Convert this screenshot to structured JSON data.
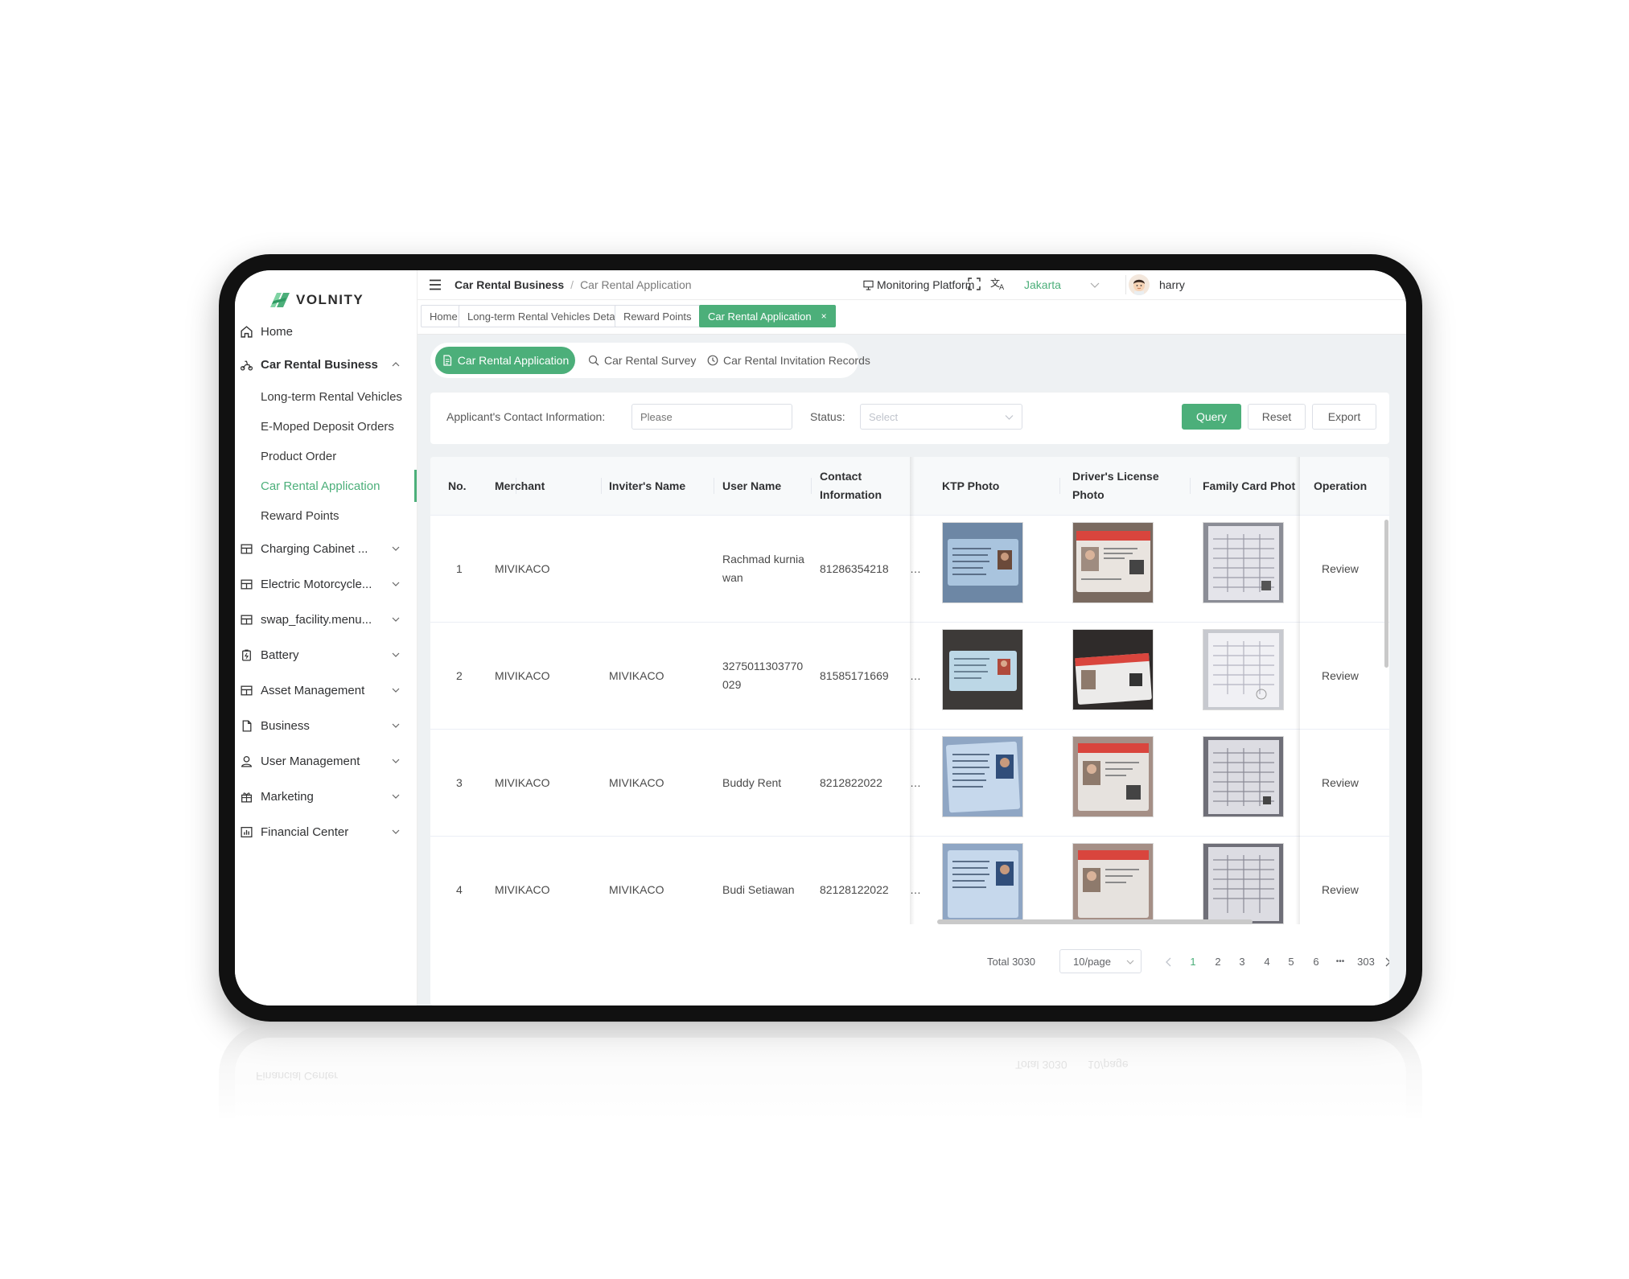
{
  "app": {
    "logo_text": "VOLNITY",
    "brand_color": "#4caf7a"
  },
  "sidebar": {
    "home": "Home",
    "car_rental_business": "Car Rental Business",
    "sub_items": [
      "Long-term Rental Vehicles",
      "E-Moped Deposit Orders",
      "Product Order",
      "Car Rental Application",
      "Reward Points"
    ],
    "groups": [
      "Charging Cabinet ...",
      "Electric Motorcycle...",
      "swap_facility.menu...",
      "Battery",
      "Asset Management",
      "Business",
      "User Management",
      "Marketing",
      "Financial Center"
    ]
  },
  "header": {
    "breadcrumb": [
      "Car Rental Business",
      "Car Rental Application"
    ],
    "monitoring": "Monitoring Platform",
    "city": "Jakarta",
    "user": "harry"
  },
  "tags": [
    {
      "label": "Home"
    },
    {
      "label": "Long-term Rental Vehicles Detail"
    },
    {
      "label": "Reward Points"
    },
    {
      "label": "Car Rental Application"
    }
  ],
  "subtabs": [
    "Car Rental Application",
    "Car Rental Survey",
    "Car Rental Invitation Records"
  ],
  "filter": {
    "contact_label": "Applicant's Contact Information:",
    "contact_placeholder": "Please",
    "status_label": "Status:",
    "status_placeholder": "Select",
    "query": "Query",
    "reset": "Reset",
    "export": "Export"
  },
  "table": {
    "columns": [
      "No.",
      "Merchant",
      "Inviter's Name",
      "User Name",
      "Contact Information",
      "KTP Photo",
      "Driver's License Photo",
      "Family Card Phot",
      "Operation"
    ],
    "rows": [
      {
        "no": "1",
        "merchant": "MIVIKACO",
        "inviter": "",
        "user": "Rachmad kurniawan",
        "contact": "81286354218",
        "trunc": "…",
        "op": "Review"
      },
      {
        "no": "2",
        "merchant": "MIVIKACO",
        "inviter": "MIVIKACO",
        "user": "3275011303770029",
        "contact": "81585171669",
        "trunc": "…",
        "op": "Review"
      },
      {
        "no": "3",
        "merchant": "MIVIKACO",
        "inviter": "MIVIKACO",
        "user": "Buddy Rent",
        "contact": "8212822022",
        "trunc": "…",
        "op": "Review"
      },
      {
        "no": "4",
        "merchant": "MIVIKACO",
        "inviter": "MIVIKACO",
        "user": "Budi Setiawan",
        "contact": "82128122022",
        "trunc": "…",
        "op": "Review"
      }
    ]
  },
  "pagination": {
    "total": "Total 3030",
    "page_size": "10/page",
    "pages": [
      "1",
      "2",
      "3",
      "4",
      "5",
      "6",
      "•••",
      "303"
    ],
    "current": "1"
  }
}
